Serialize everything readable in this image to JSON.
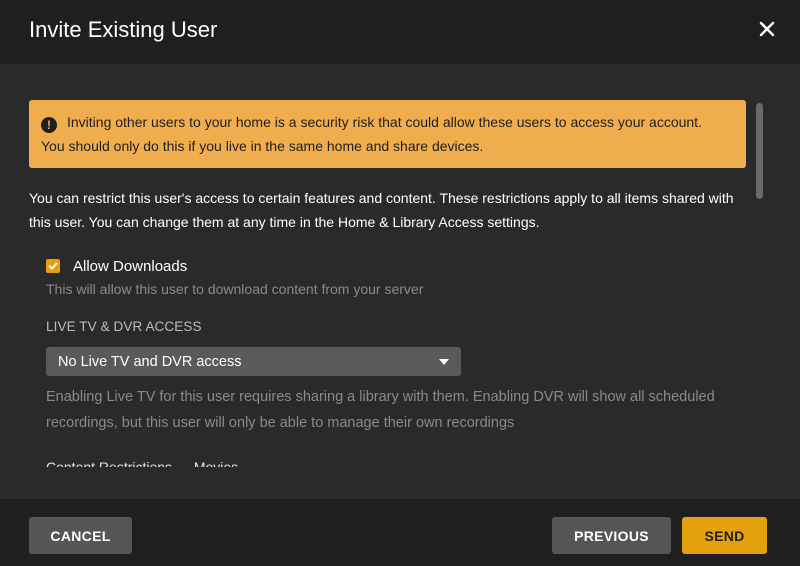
{
  "dialog": {
    "title": "Invite Existing User"
  },
  "warning": {
    "icon": "exclamation-circle-icon",
    "line1": "Inviting other users to your home is a security risk that could allow these users to access your account.",
    "line2": "You should only do this if you live in the same home and share devices."
  },
  "intro": {
    "text": "You can restrict this user's access to certain features and content. These restrictions apply to all items shared with this user. You can change them at any time in the Home & Library Access settings."
  },
  "downloads": {
    "label": "Allow Downloads",
    "checked": true,
    "help": "This will allow this user to download content from your server"
  },
  "live_tv": {
    "section_label": "LIVE TV & DVR ACCESS",
    "selected": "No Live TV and DVR access",
    "help": "Enabling Live TV for this user requires sharing a library with them. Enabling DVR will show all scheduled recordings, but this user will only be able to manage their own recordings"
  },
  "content_restrictions": {
    "heading": "Content Restrictions — Movies"
  },
  "footer": {
    "cancel_label": "CANCEL",
    "previous_label": "PREVIOUS",
    "send_label": "SEND"
  },
  "colors": {
    "accent": "#e5a00d",
    "warning_bg": "#f0ad4e",
    "body_bg": "#2a2a2a",
    "header_bg": "#1f1f1f"
  }
}
